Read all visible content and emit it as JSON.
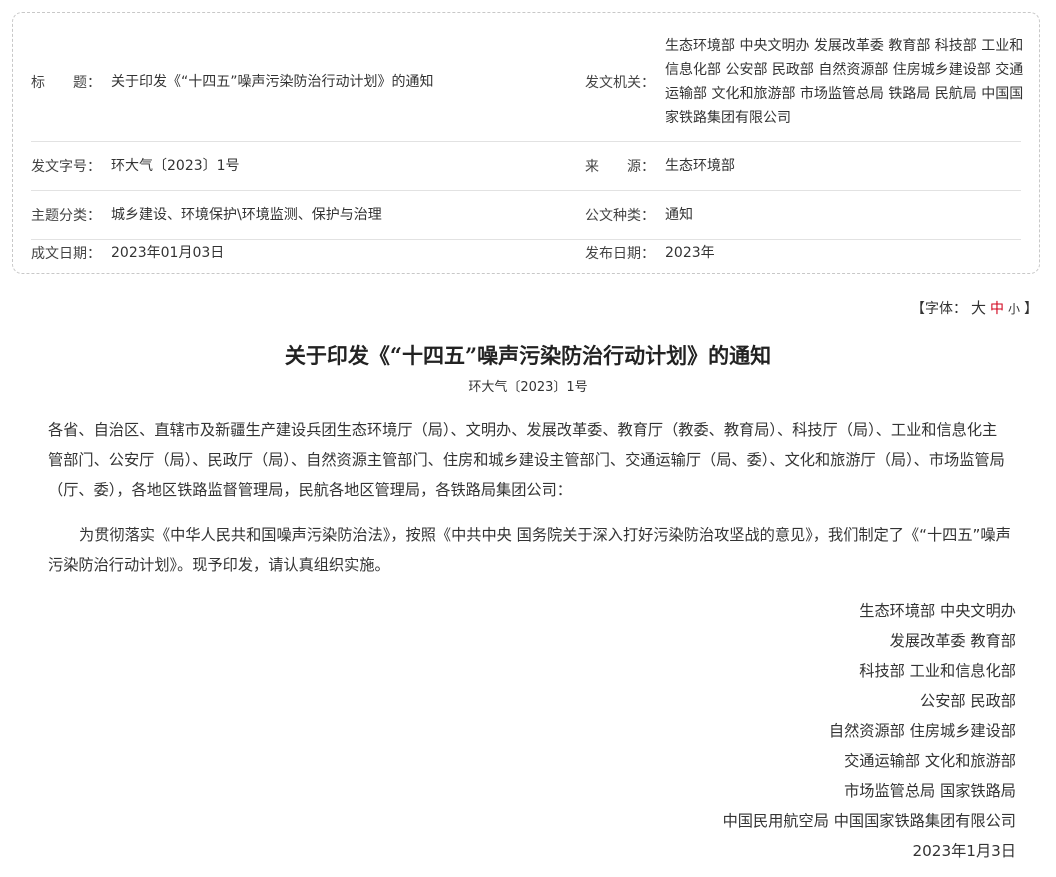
{
  "meta": {
    "title_label": "标　　题：",
    "title_value": "关于印发《“十四五”噪声污染防治行动计划》的通知",
    "issuer_label": "发文机关：",
    "issuer_value": "生态环境部 中央文明办 发展改革委 教育部 科技部 工业和信息化部 公安部 民政部 自然资源部 住房城乡建设部 交通运输部 文化和旅游部 市场监管总局 铁路局 民航局 中国国家铁路集团有限公司",
    "docno_label": "发文字号：",
    "docno_value": "环大气〔2023〕1号",
    "source_label": "来　　源：",
    "source_value": "生态环境部",
    "topic_label": "主题分类：",
    "topic_value": "城乡建设、环境保护\\环境监测、保护与治理",
    "type_label": "公文种类：",
    "type_value": "通知",
    "written_label": "成文日期：",
    "written_value": "2023年01月03日",
    "published_label": "发布日期：",
    "published_value": "2023年"
  },
  "font_size": {
    "prefix": "【字体：",
    "large": "大",
    "medium": "中",
    "small": "小",
    "suffix": "】"
  },
  "article": {
    "title": "关于印发《“十四五”噪声污染防治行动计划》的通知",
    "doc_number": "环大气〔2023〕1号",
    "para1": "各省、自治区、直辖市及新疆生产建设兵团生态环境厅（局）、文明办、发展改革委、教育厅（教委、教育局）、科技厅（局）、工业和信息化主管部门、公安厅（局）、民政厅（局）、自然资源主管部门、住房和城乡建设主管部门、交通运输厅（局、委）、文化和旅游厅（局）、市场监管局（厅、委），各地区铁路监督管理局，民航各地区管理局，各铁路局集团公司：",
    "para2": "为贯彻落实《中华人民共和国噪声污染防治法》，按照《中共中央 国务院关于深入打好污染防治攻坚战的意见》，我们制定了《“十四五”噪声污染防治行动计划》。现予印发，请认真组织实施。",
    "signatures": [
      "生态环境部 中央文明办",
      "发展改革委 教育部",
      "科技部 工业和信息化部",
      "公安部 民政部",
      "自然资源部 住房城乡建设部",
      "交通运输部 文化和旅游部",
      "市场监管总局 国家铁路局",
      "中国民用航空局 中国国家铁路集团有限公司",
      "2023年1月3日"
    ]
  },
  "colors": {
    "accent_red": "#d0021b",
    "border": "#c8c8c8"
  }
}
